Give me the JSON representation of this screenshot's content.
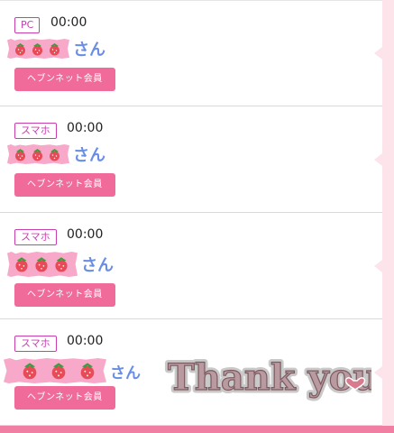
{
  "colors": {
    "accent": "#f06b9a",
    "tag": "#c93fb0",
    "name": "#6a8ee6",
    "tape": "#f8a9c9",
    "sidebar": "#fde3ea"
  },
  "items": [
    {
      "device": "PC",
      "time": "00:00",
      "suffix": "さん",
      "button": "ヘブンネット会員"
    },
    {
      "device": "スマホ",
      "time": "00:00",
      "suffix": "さん",
      "button": "ヘブンネット会員"
    },
    {
      "device": "スマホ",
      "time": "00:00",
      "suffix": "さん",
      "button": "ヘブンネット会員"
    },
    {
      "device": "スマホ",
      "time": "00:00",
      "suffix": "さん",
      "button": "ヘブンネット会員"
    }
  ],
  "sticker": {
    "text": "Thank you",
    "icon": "heart-icon"
  }
}
